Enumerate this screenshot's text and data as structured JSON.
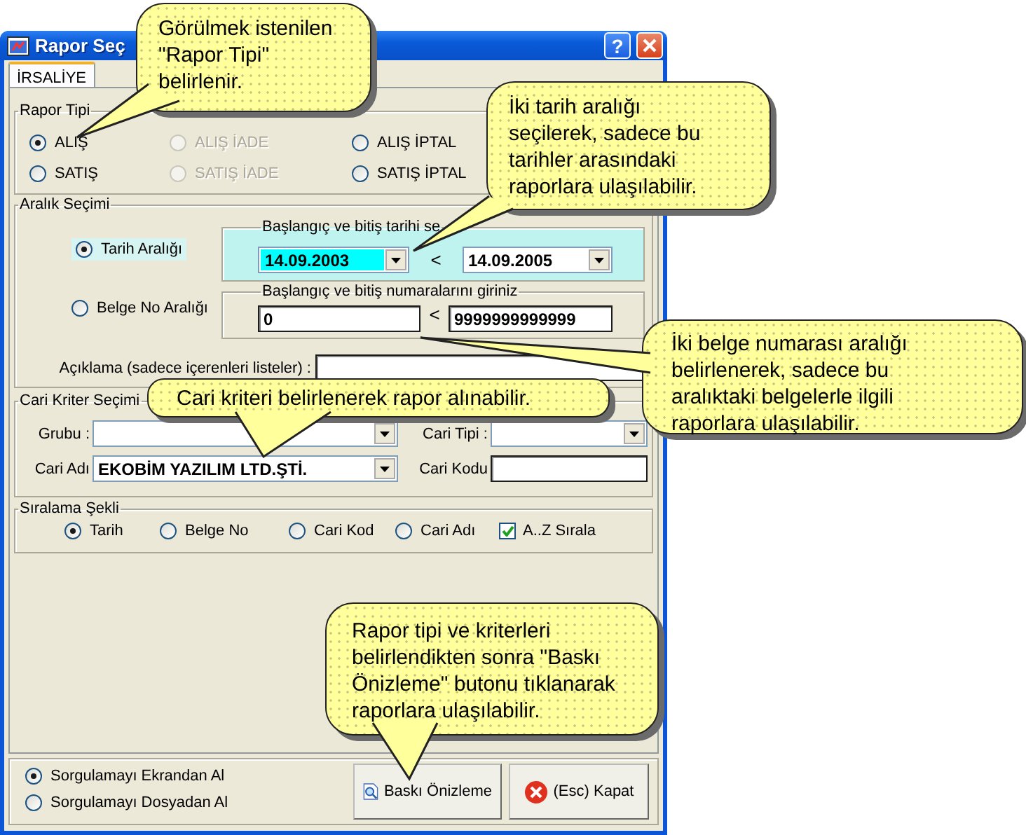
{
  "window": {
    "title": "Rapor Seç",
    "help_glyph": "?"
  },
  "tabs": [
    {
      "label": "İRSALİYE",
      "selected": true
    }
  ],
  "report_type": {
    "legend": "Rapor Tipi",
    "options": [
      {
        "label": "ALIŞ",
        "selected": true,
        "disabled": false
      },
      {
        "label": "ALIŞ İADE",
        "selected": false,
        "disabled": true
      },
      {
        "label": "ALIŞ İPTAL",
        "selected": false,
        "disabled": false
      },
      {
        "label": "SATIŞ",
        "selected": false,
        "disabled": false
      },
      {
        "label": "SATIŞ İADE",
        "selected": false,
        "disabled": true
      },
      {
        "label": "SATIŞ İPTAL",
        "selected": false,
        "disabled": false
      }
    ]
  },
  "range": {
    "legend": "Aralık Seçimi",
    "modes": [
      {
        "label": "Tarih Aralığı",
        "selected": true
      },
      {
        "label": "Belge No Aralığı",
        "selected": false
      }
    ],
    "date_group": {
      "legend": "Başlangıç ve bitiş tarihi se",
      "start": "14.09.2003",
      "start_selected": true,
      "separator": "<",
      "end": "14.09.2005"
    },
    "number_group": {
      "legend": "Başlangıç ve bitiş numaralarını giriniz",
      "start": "0",
      "separator": "<",
      "end": "9999999999999"
    },
    "description_label": "Açıklama (sadece içerenleri listeler) :"
  },
  "account": {
    "legend": "Cari Kriter Seçimi",
    "group_label": "Grubu :",
    "type_label": "Cari Tipi :",
    "name_label": "Cari Adı",
    "name_value": "EKOBİM YAZILIM LTD.ŞTİ.",
    "code_label": "Cari Kodu"
  },
  "sorting": {
    "legend": "Sıralama Şekli",
    "options": [
      {
        "label": "Tarih",
        "selected": true
      },
      {
        "label": "Belge No",
        "selected": false
      },
      {
        "label": "Cari Kod",
        "selected": false
      },
      {
        "label": "Cari Adı",
        "selected": false
      }
    ],
    "az": {
      "label": "A..Z Sırala",
      "checked": true
    }
  },
  "source_options": [
    {
      "label": "Sorgulamayı Ekrandan Al",
      "selected": true
    },
    {
      "label": "Sorgulamayı Dosyadan Al",
      "selected": false
    }
  ],
  "buttons": [
    {
      "label": "Baskı Önizleme",
      "kind": "preview"
    },
    {
      "label": "(Esc) Kapat",
      "kind": "close"
    }
  ],
  "callouts": [
    {
      "text": "Görülmek istenilen \"Rapor Tipi\" belirlenir."
    },
    {
      "text": "İki tarih aralığı seçilerek, sadece bu tarihler arasındaki raporlara ulaşılabilir."
    },
    {
      "text": "Cari kriteri belirlenerek rapor alınabilir."
    },
    {
      "text": "İki belge numarası aralığı belirlenerek, sadece bu aralıktaki belgelerle ilgili raporlara ulaşılabilir."
    },
    {
      "text": "Rapor tipi ve kriterleri belirlendikten sonra \"Baskı Önizleme\" butonu tıklanarak raporlara ulaşılabilir."
    }
  ]
}
